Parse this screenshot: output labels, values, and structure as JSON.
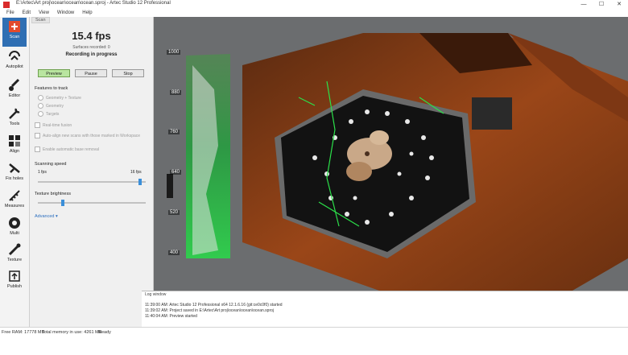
{
  "window": {
    "title": "E:\\Artec\\Art proj\\ocean\\ocean\\ocean.sproj - Artec Studio 12 Professional",
    "controls": {
      "minimize": "—",
      "maximize": "☐",
      "close": "✕"
    }
  },
  "menu": [
    "File",
    "Edit",
    "View",
    "Window",
    "Help"
  ],
  "toolbar": {
    "items": [
      {
        "label": "Scan",
        "icon": "scan-icon"
      },
      {
        "label": "Autopilot",
        "icon": "autopilot-icon"
      },
      {
        "label": "Editor",
        "icon": "brush-icon"
      },
      {
        "label": "Tools",
        "icon": "tools-icon"
      },
      {
        "label": "Align",
        "icon": "align-icon"
      },
      {
        "label": "Fix holes",
        "icon": "fix-holes-icon"
      },
      {
        "label": "Measures",
        "icon": "measures-icon"
      },
      {
        "label": "Multi",
        "icon": "multi-icon"
      },
      {
        "label": "Texture",
        "icon": "texture-icon"
      },
      {
        "label": "Publish",
        "icon": "publish-icon"
      }
    ],
    "active": "Scan"
  },
  "scan_panel": {
    "tab": "Scan",
    "fps": "15.4 fps",
    "surfaces_recorded": "Surfaces recorded: 0",
    "status": "Recording in progress",
    "buttons": {
      "preview": "Preview",
      "pause": "Pause",
      "stop": "Stop"
    },
    "features_label": "Features to track",
    "features": [
      "Geometry + Texture",
      "Geometry",
      "Targets"
    ],
    "options": [
      "Real-time fusion",
      "Auto-align new scans with those marked in Workspace",
      "Enable automatic base removal"
    ],
    "scanning_speed_label": "Scanning speed",
    "speed_min": "1 fps",
    "speed_max": "16 fps",
    "speed_value_fraction": 0.96,
    "texture_brightness_label": "Texture brightness",
    "brightness_value_fraction": 0.22,
    "advanced_label": "Advanced ▾"
  },
  "viewport": {
    "depth_ticks": [
      "1000",
      "880",
      "760",
      "640",
      "520",
      "400"
    ]
  },
  "log": {
    "title": "Log window",
    "lines": [
      "11:39:00 AM: Artec Studio 12 Professional x64 12.1.6.16 (git:ce0c0f0) started",
      "11:39:02 AM: Project saved in E:\\Artec\\Art proj\\ocean\\ocean\\ocean.sproj",
      "11:40:04 AM: Preview started"
    ]
  },
  "statusbar": {
    "free_ram": "Free RAM: 17778 MB",
    "total_memory": "Total memory in use: 4261 MB",
    "state": "Ready"
  },
  "colors": {
    "accent": "#2f6fb3",
    "preview_button": "#b9e5a0",
    "scan_surface": "#8a3a12",
    "depth_green": "#22c43a"
  }
}
